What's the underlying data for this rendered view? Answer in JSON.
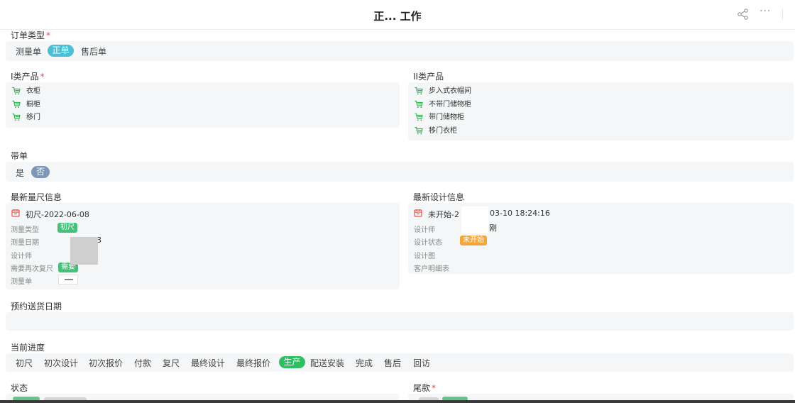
{
  "header": {
    "title": "正... 工作",
    "more": "···"
  },
  "order_type": {
    "label": "订单类型",
    "required": "*",
    "options": [
      "测量单",
      "正单",
      "售后单"
    ],
    "selected": "正单"
  },
  "class1": {
    "label": "I类产品",
    "required": "*",
    "items": [
      "衣柜",
      "橱柜",
      "移门"
    ]
  },
  "class2": {
    "label": "II类产品",
    "items": [
      "步入式衣帽间",
      "不带门储物柜",
      "带门储物柜",
      "移门衣柜"
    ]
  },
  "dai_dan": {
    "label": "带单",
    "options": [
      "是",
      "否"
    ],
    "selected": "否"
  },
  "measure": {
    "label": "最新量尺信息",
    "title": "初尺-2022-06-08",
    "fields": [
      "测量类型",
      "测量日期",
      "设计师",
      "需要再次复尺",
      "测量单"
    ],
    "type_badge": "初尺",
    "date_partial": "3",
    "again_badge": "需要"
  },
  "design": {
    "label": "最新设计信息",
    "title_left": "未开始-2",
    "title_right": "03-10 18:24:16",
    "fields": [
      "设计师",
      "设计状态",
      "设计图",
      "客户明细表"
    ],
    "designer_partial": "刚",
    "status_badge": "未开始"
  },
  "delivery": {
    "label": "预约送货日期"
  },
  "progress": {
    "label": "当前进度",
    "steps": [
      "初尺",
      "初次设计",
      "初次报价",
      "付款",
      "复尺",
      "最终设计",
      "最终报价",
      "生产",
      "配送安装",
      "完成",
      "售后",
      "回访"
    ],
    "current": "生产"
  },
  "status": {
    "label": "状态"
  },
  "balance": {
    "label": "尾款",
    "required": "*"
  },
  "colors": {
    "teal": "#4dbfd4",
    "slate": "#7f97b6",
    "green": "#2fbf62",
    "orange": "#f4a63a",
    "cart": "#3cb35a",
    "calendar": "#e5534b",
    "required": "#e84a4a"
  }
}
